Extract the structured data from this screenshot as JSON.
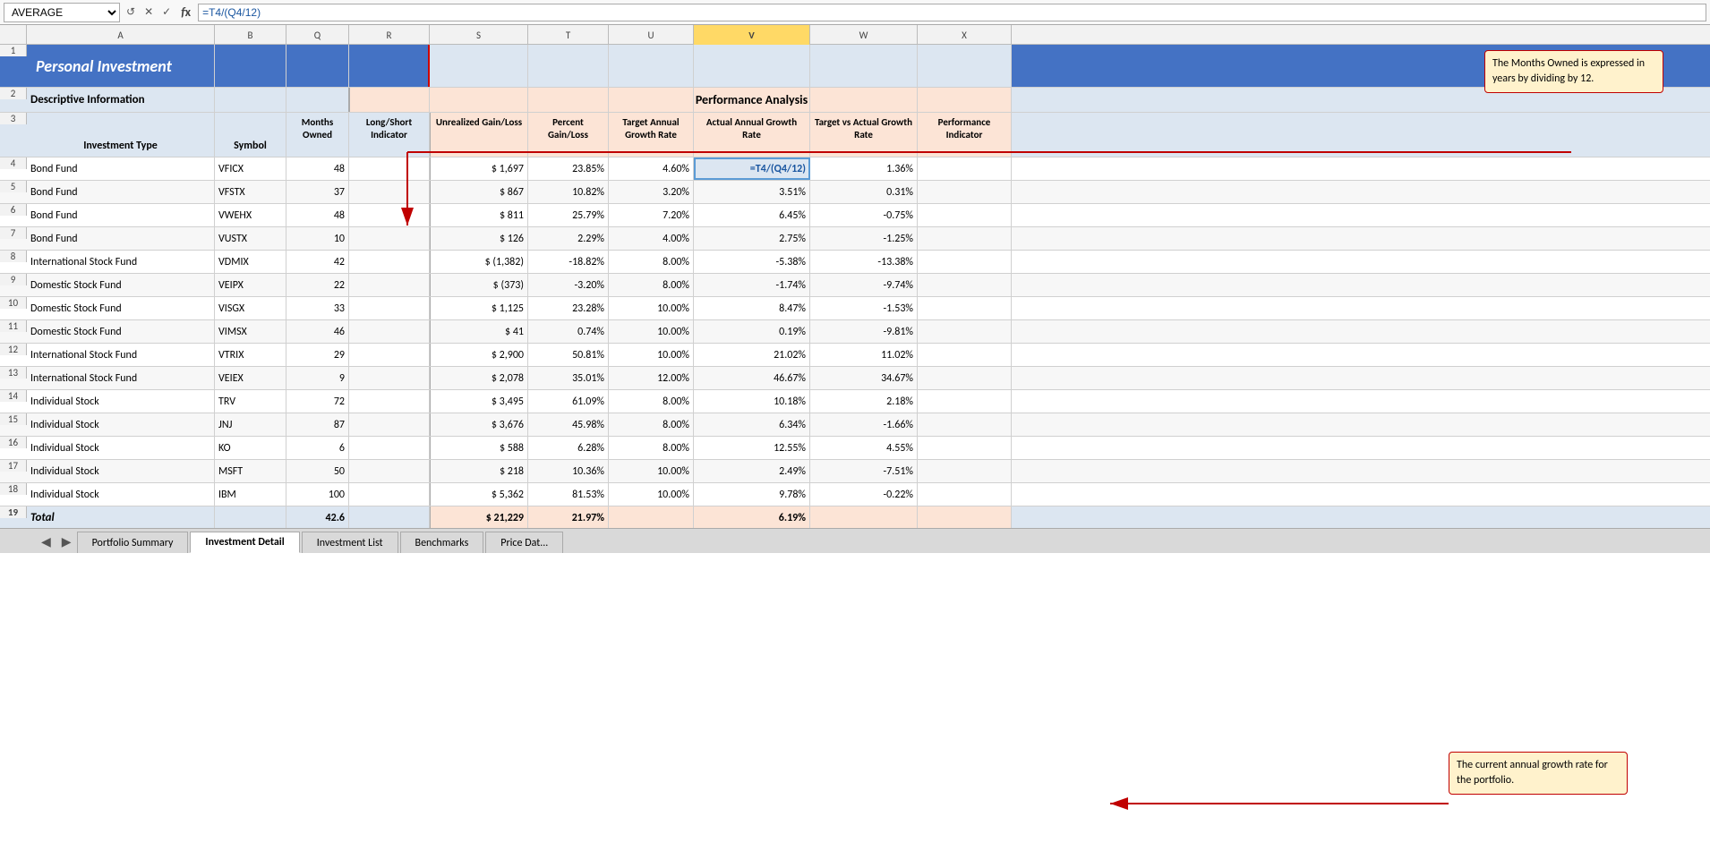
{
  "formulaBar": {
    "nameBox": "AVERAGE",
    "formula": "=T4/(Q4/12)"
  },
  "columns": [
    "A",
    "B",
    "Q",
    "R",
    "S",
    "T",
    "U",
    "V",
    "W",
    "X"
  ],
  "columnLabels": {
    "A": "A",
    "B": "B",
    "Q": "Q",
    "R": "R",
    "S": "S",
    "T": "T",
    "U": "U",
    "V": "V",
    "W": "W",
    "X": "X"
  },
  "title": "Personal Investment",
  "row2": {
    "descInfo": "Descriptive Information",
    "perfAnalysis": "Performance Analysis"
  },
  "headers": {
    "A": "Investment Type",
    "B": "Symbol",
    "Q": "Months Owned",
    "R": "Long/Short Indicator",
    "S": "Unrealized Gain/Loss",
    "T": "Percent Gain/Loss",
    "U": "Target Annual Growth Rate",
    "V": "Actual Annual Growth Rate",
    "W": "Target vs Actual Growth Rate",
    "X": "Performance Indicator"
  },
  "rows": [
    {
      "num": 4,
      "A": "Bond Fund",
      "B": "VFICX",
      "Q": "48",
      "R": "",
      "S": "$  1,697",
      "T": "23.85%",
      "U": "4.60%",
      "V": "=T4/(Q4/12)",
      "W": "1.36%",
      "X": ""
    },
    {
      "num": 5,
      "A": "Bond Fund",
      "B": "VFSTX",
      "Q": "37",
      "R": "",
      "S": "$    867",
      "T": "10.82%",
      "U": "3.20%",
      "V": "3.51%",
      "W": "0.31%",
      "X": ""
    },
    {
      "num": 6,
      "A": "Bond Fund",
      "B": "VWEHX",
      "Q": "48",
      "R": "",
      "S": "$    811",
      "T": "25.79%",
      "U": "7.20%",
      "V": "6.45%",
      "W": "-0.75%",
      "X": ""
    },
    {
      "num": 7,
      "A": "Bond Fund",
      "B": "VUSTX",
      "Q": "10",
      "R": "",
      "S": "$    126",
      "T": "2.29%",
      "U": "4.00%",
      "V": "2.75%",
      "W": "-1.25%",
      "X": ""
    },
    {
      "num": 8,
      "A": "International Stock Fund",
      "B": "VDMIX",
      "Q": "42",
      "R": "",
      "S": "$ (1,382)",
      "T": "-18.82%",
      "U": "8.00%",
      "V": "-5.38%",
      "W": "-13.38%",
      "X": ""
    },
    {
      "num": 9,
      "A": "Domestic Stock Fund",
      "B": "VEIPX",
      "Q": "22",
      "R": "",
      "S": "$  (373)",
      "T": "-3.20%",
      "U": "8.00%",
      "V": "-1.74%",
      "W": "-9.74%",
      "X": ""
    },
    {
      "num": 10,
      "A": "Domestic Stock Fund",
      "B": "VISGX",
      "Q": "33",
      "R": "",
      "S": "$  1,125",
      "T": "23.28%",
      "U": "10.00%",
      "V": "8.47%",
      "W": "-1.53%",
      "X": ""
    },
    {
      "num": 11,
      "A": "Domestic Stock Fund",
      "B": "VIMSX",
      "Q": "46",
      "R": "",
      "S": "$     41",
      "T": "0.74%",
      "U": "10.00%",
      "V": "0.19%",
      "W": "-9.81%",
      "X": ""
    },
    {
      "num": 12,
      "A": "International Stock Fund",
      "B": "VTRIX",
      "Q": "29",
      "R": "",
      "S": "$  2,900",
      "T": "50.81%",
      "U": "10.00%",
      "V": "21.02%",
      "W": "11.02%",
      "X": ""
    },
    {
      "num": 13,
      "A": "International Stock Fund",
      "B": "VEIEX",
      "Q": "9",
      "R": "",
      "S": "$  2,078",
      "T": "35.01%",
      "U": "12.00%",
      "V": "46.67%",
      "W": "34.67%",
      "X": ""
    },
    {
      "num": 14,
      "A": "Individual Stock",
      "B": "TRV",
      "Q": "72",
      "R": "",
      "S": "$  3,495",
      "T": "61.09%",
      "U": "8.00%",
      "V": "10.18%",
      "W": "2.18%",
      "X": ""
    },
    {
      "num": 15,
      "A": "Individual Stock",
      "B": "JNJ",
      "Q": "87",
      "R": "",
      "S": "$  3,676",
      "T": "45.98%",
      "U": "8.00%",
      "V": "6.34%",
      "W": "-1.66%",
      "X": ""
    },
    {
      "num": 16,
      "A": "Individual Stock",
      "B": "KO",
      "Q": "6",
      "R": "",
      "S": "$    588",
      "T": "6.28%",
      "U": "8.00%",
      "V": "12.55%",
      "W": "4.55%",
      "X": ""
    },
    {
      "num": 17,
      "A": "Individual Stock",
      "B": "MSFT",
      "Q": "50",
      "R": "",
      "S": "$    218",
      "T": "10.36%",
      "U": "10.00%",
      "V": "2.49%",
      "W": "-7.51%",
      "X": ""
    },
    {
      "num": 18,
      "A": "Individual Stock",
      "B": "IBM",
      "Q": "100",
      "R": "",
      "S": "$  5,362",
      "T": "81.53%",
      "U": "10.00%",
      "V": "9.78%",
      "W": "-0.22%",
      "X": ""
    }
  ],
  "totalRow": {
    "num": 19,
    "A": "Total",
    "Q": "42.6",
    "S": "$ 21,229",
    "T": "21.97%",
    "V": "6.19%"
  },
  "callout1": {
    "text": "The Months Owned is expressed in years by dividing by 12."
  },
  "callout2": {
    "text": "The current annual growth rate for the portfolio."
  },
  "tabs": [
    "Portfolio Summary",
    "Investment Detail",
    "Investment List",
    "Benchmarks",
    "Price Dat..."
  ],
  "activeTab": "Investment Detail"
}
